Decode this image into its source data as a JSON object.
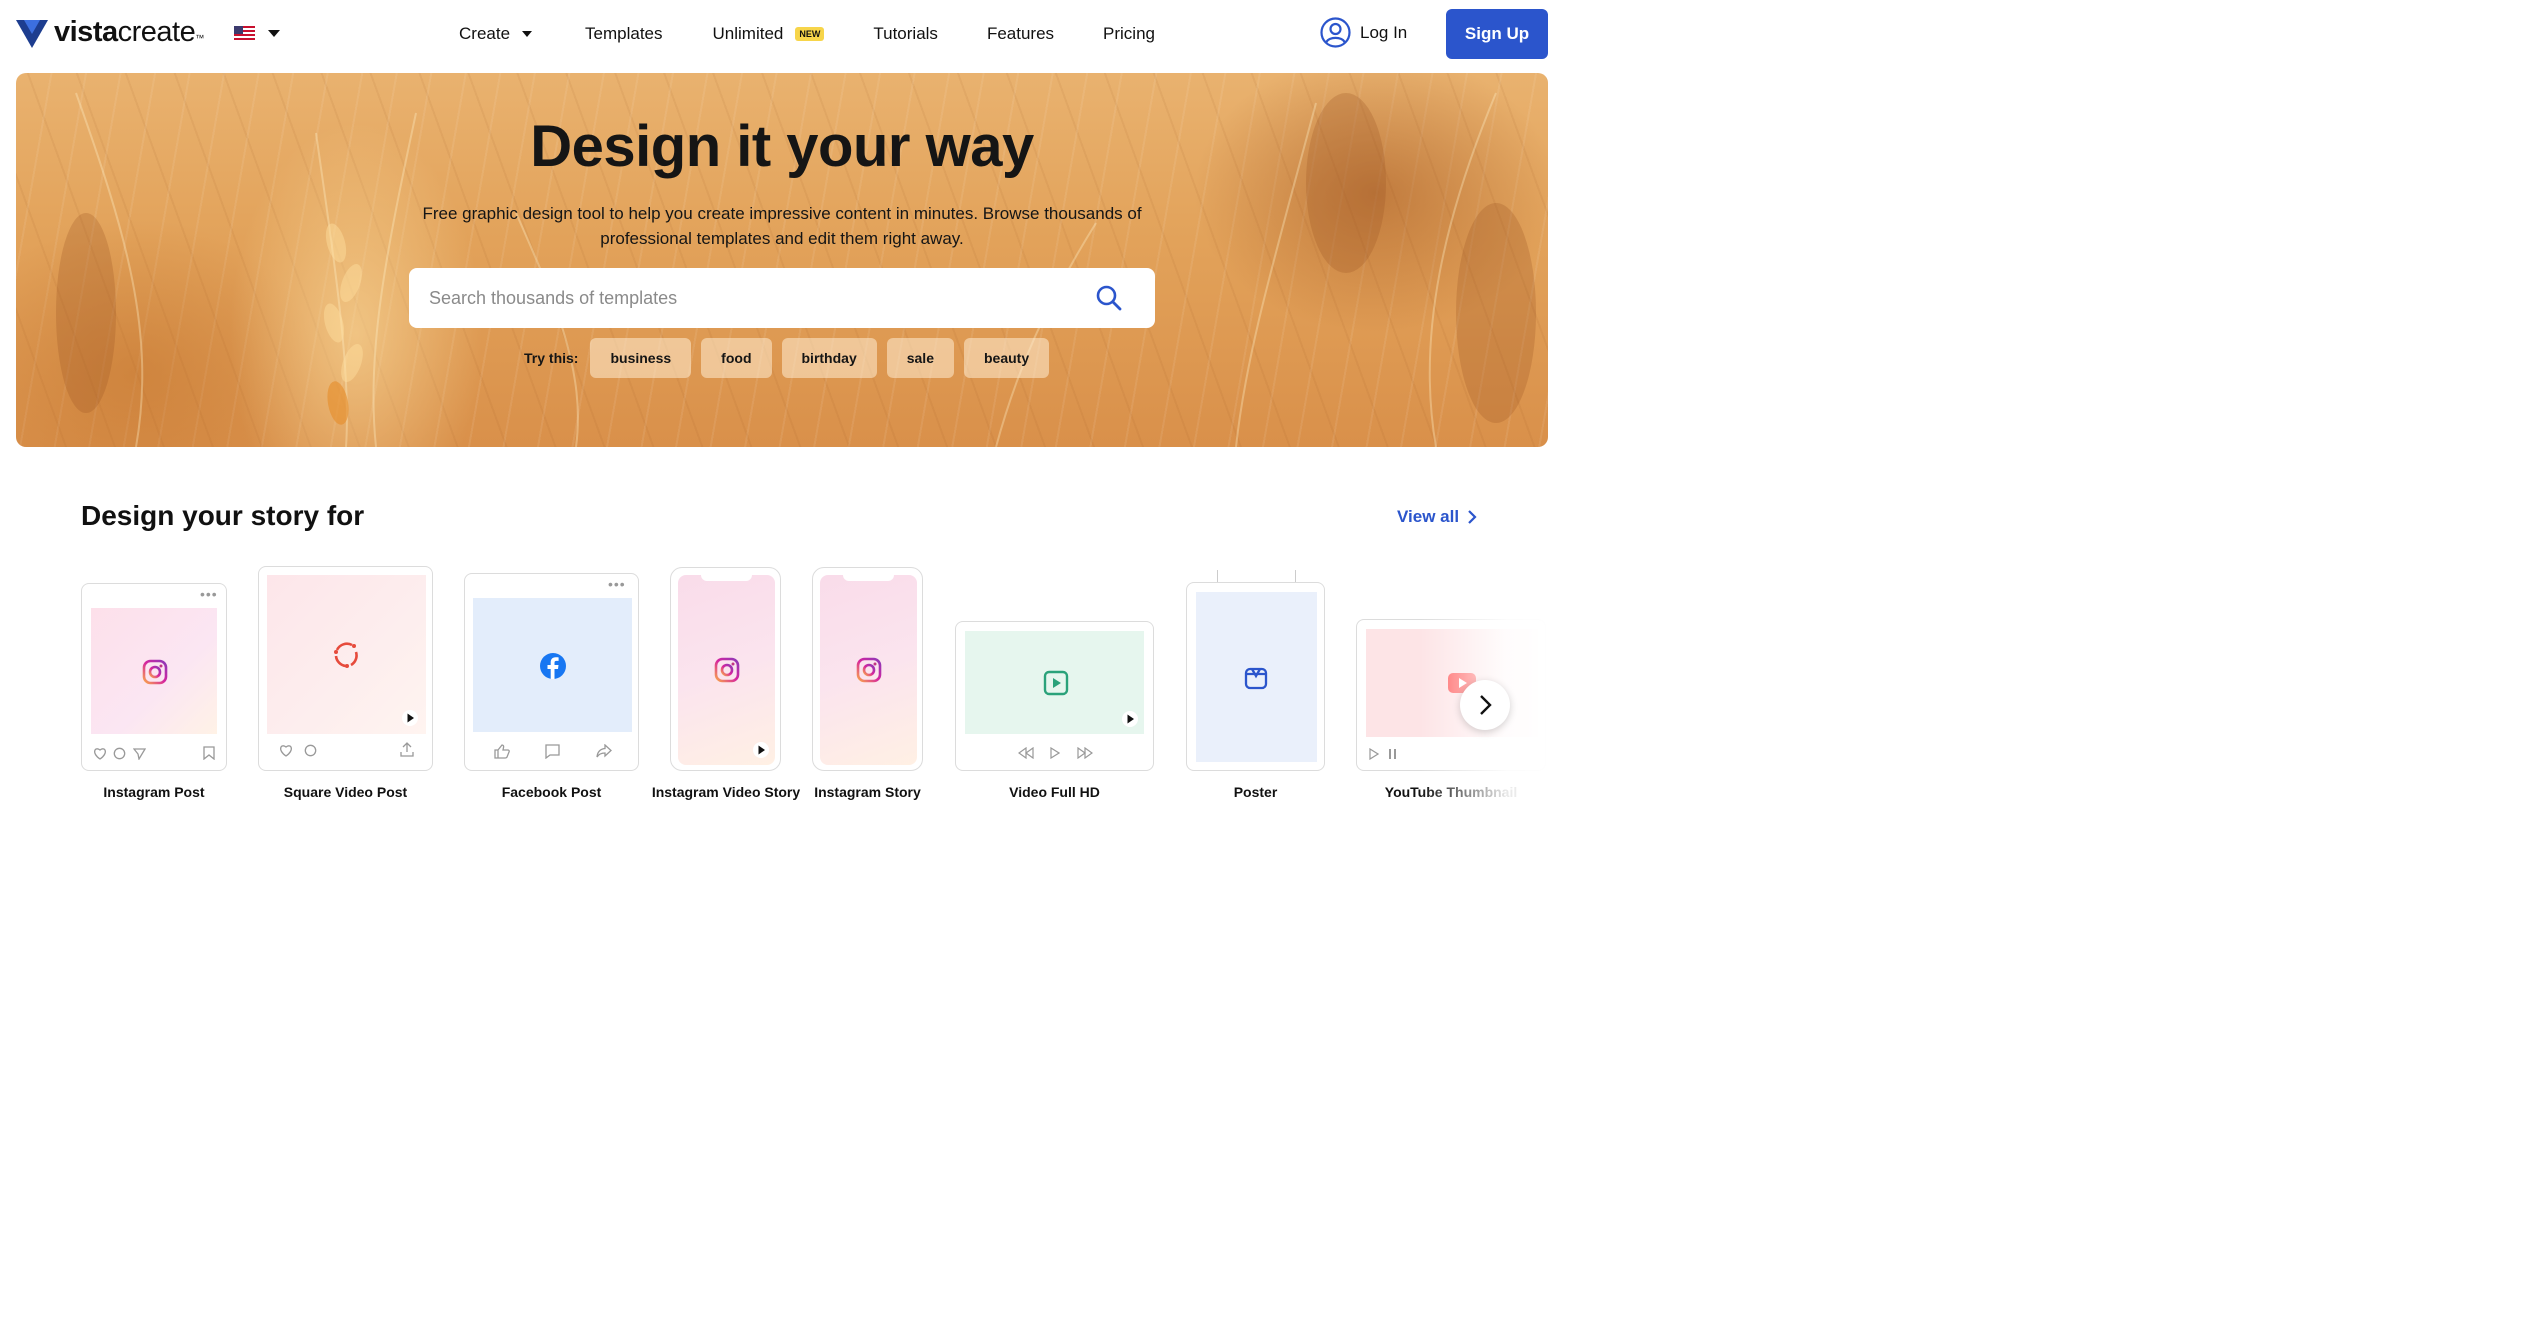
{
  "brand": {
    "name_bold": "vista",
    "name_light": "create",
    "tm": "™"
  },
  "header": {
    "nav": [
      {
        "label": "Create",
        "has_caret": true
      },
      {
        "label": "Templates"
      },
      {
        "label": "Unlimited",
        "badge": "NEW"
      },
      {
        "label": "Tutorials"
      },
      {
        "label": "Features"
      },
      {
        "label": "Pricing"
      }
    ],
    "login_label": "Log In",
    "signup_label": "Sign Up"
  },
  "hero": {
    "title": "Design it your way",
    "subtitle": "Free graphic design tool to help you create impressive content in minutes. Browse thousands of professional templates and edit them right away.",
    "search_placeholder": "Search thousands of templates",
    "try_label": "Try this:",
    "chips": [
      "business",
      "food",
      "birthday",
      "sale",
      "beauty"
    ]
  },
  "story": {
    "title": "Design your story for",
    "view_all": "View all",
    "cards": [
      {
        "label": "Instagram Post"
      },
      {
        "label": "Square Video Post"
      },
      {
        "label": "Facebook Post"
      },
      {
        "label": "Instagram Video Story"
      },
      {
        "label": "Instagram Story"
      },
      {
        "label": "Video Full HD"
      },
      {
        "label": "Poster"
      },
      {
        "label": "YouTube Thumbnail"
      }
    ]
  },
  "colors": {
    "accent": "#2b55cc",
    "badge": "#f7d54a",
    "instagram_gradient": [
      "#f9a74b",
      "#d6249f",
      "#8a3ab9"
    ],
    "facebook": "#1877f2",
    "video_green": "#2aa27a"
  }
}
